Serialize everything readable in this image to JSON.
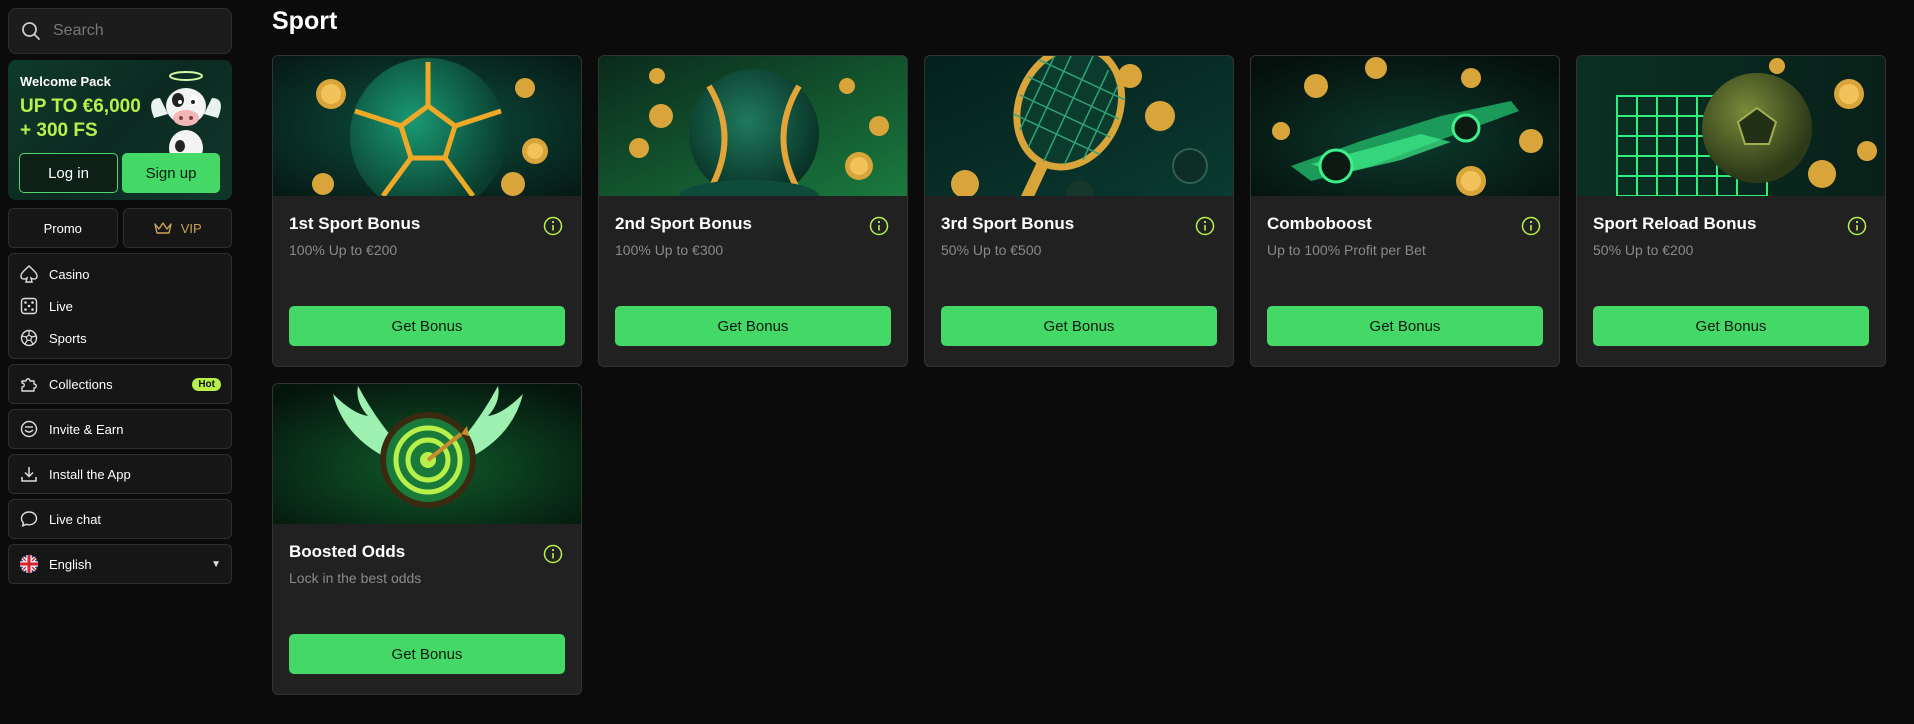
{
  "search": {
    "placeholder": "Search"
  },
  "welcome_banner": {
    "title": "Welcome Pack",
    "line1": "UP TO €6,000",
    "line2": "+ 300 FS",
    "login_label": "Log in",
    "signup_label": "Sign up"
  },
  "pills": {
    "promo": "Promo",
    "vip": "VIP"
  },
  "nav": {
    "casino": "Casino",
    "live": "Live",
    "sports": "Sports",
    "collections": "Collections",
    "hot_badge": "Hot",
    "invite": "Invite & Earn",
    "install": "Install the App",
    "livechat": "Live chat",
    "language": "English"
  },
  "page": {
    "title": "Sport"
  },
  "cards": [
    {
      "title": "1st Sport Bonus",
      "subtitle": "100% Up to €200",
      "button": "Get Bonus",
      "art": "soccer-ball"
    },
    {
      "title": "2nd Sport Bonus",
      "subtitle": "100% Up to €300",
      "button": "Get Bonus",
      "art": "baseball"
    },
    {
      "title": "3rd Sport Bonus",
      "subtitle": "50% Up to €500",
      "button": "Get Bonus",
      "art": "tennis-racket"
    },
    {
      "title": "Comboboost",
      "subtitle": "Up to 100% Profit per Bet",
      "button": "Get Bonus",
      "art": "race-car"
    },
    {
      "title": "Sport Reload Bonus",
      "subtitle": "50% Up to €200",
      "button": "Get Bonus",
      "art": "soccer-goal"
    },
    {
      "title": "Boosted Odds",
      "subtitle": "Lock in the best odds",
      "button": "Get Bonus",
      "art": "winged-target"
    }
  ],
  "colors": {
    "accent": "#44d866",
    "lime": "#b7f04a",
    "gold": "#d9a53a",
    "card_bg": "#212121",
    "page_bg": "#0b0b0b"
  }
}
